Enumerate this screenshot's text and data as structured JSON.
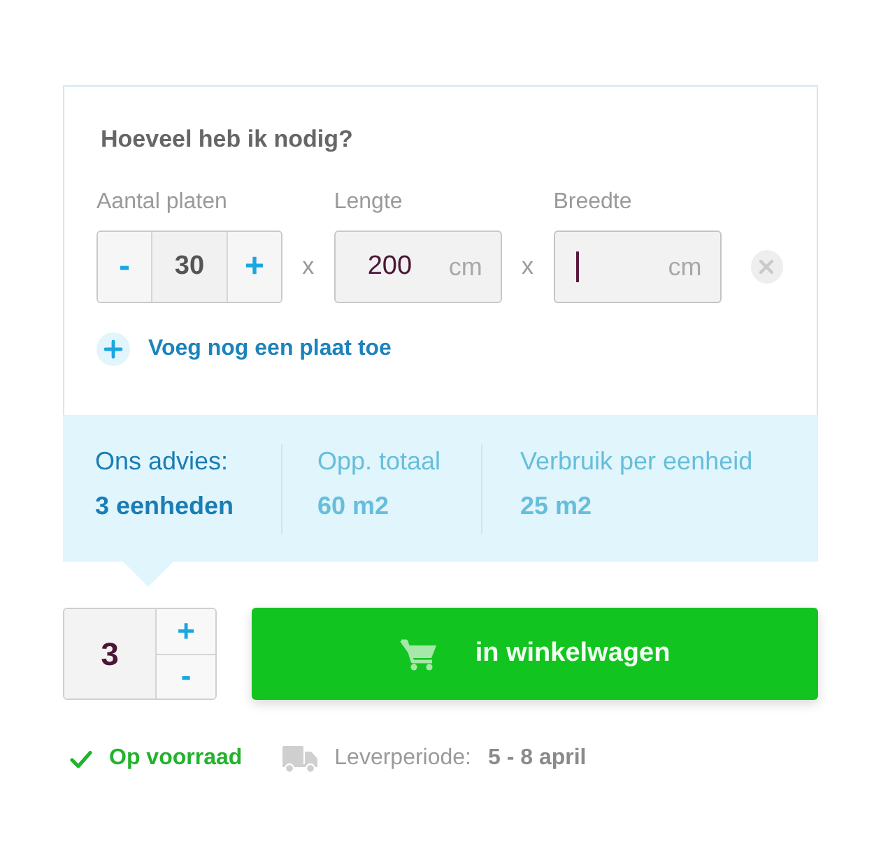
{
  "calculator": {
    "title": "Hoeveel heb ik nodig?",
    "inputs": [
      {
        "kind": "stepper",
        "label": "Aantal platen",
        "decrement": "-",
        "value": "30",
        "increment": "+"
      },
      {
        "kind": "operator",
        "text": "x"
      },
      {
        "kind": "measure",
        "label": "Lengte",
        "value": "200",
        "unit": "cm",
        "focused": false
      },
      {
        "kind": "operator",
        "text": "x"
      },
      {
        "kind": "measure",
        "label": "Breedte",
        "unit": "cm",
        "focused": true
      }
    ],
    "add_link": "Voeg nog een plaat toe"
  },
  "advice": [
    {
      "label": "Ons advies:",
      "value": "3 eenheden",
      "highlighted": true
    },
    {
      "label": "Opp. totaal",
      "value": "60 m2",
      "highlighted": false
    },
    {
      "label": "Verbruik per eenheid",
      "value": "25 m2",
      "highlighted": false
    }
  ],
  "cart": {
    "quantity": "3",
    "increment": "+",
    "decrement": "-",
    "button": "in winkelwagen"
  },
  "availability": {
    "stock": "Op voorraad",
    "in_stock": true,
    "delivery_label": "Leverperiode:",
    "delivery_value": "5 - 8 april"
  }
}
